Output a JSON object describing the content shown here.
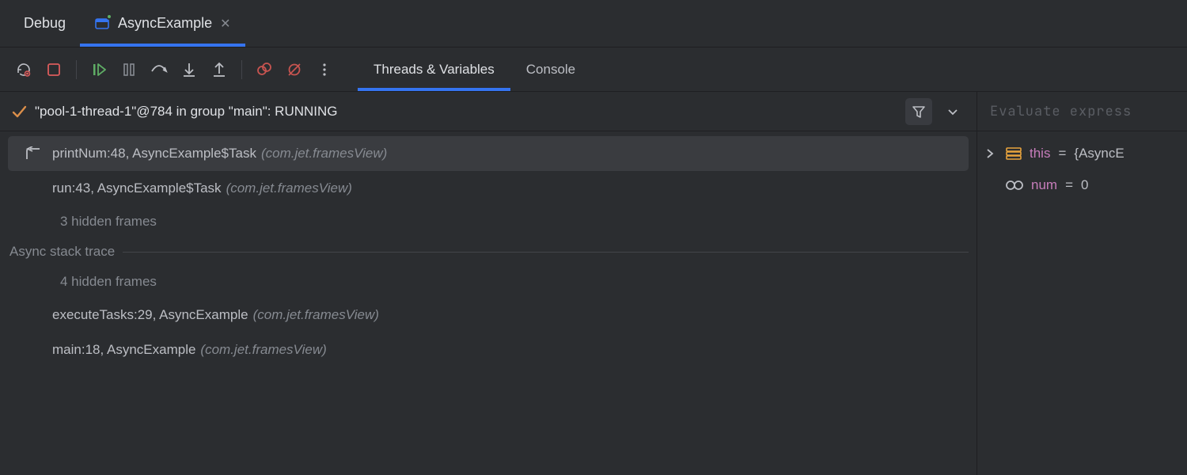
{
  "toolWindow": {
    "title": "Debug"
  },
  "runConfig": {
    "name": "AsyncExample"
  },
  "subTabs": {
    "threadsVariables": "Threads & Variables",
    "console": "Console"
  },
  "thread": {
    "label": "\"pool-1-thread-1\"@784 in group \"main\": RUNNING"
  },
  "frames": {
    "selected": {
      "text": "printNum:48, AsyncExample$Task",
      "pkg": "(com.jet.framesView)"
    },
    "f1": {
      "text": "run:43, AsyncExample$Task",
      "pkg": "(com.jet.framesView)"
    },
    "hidden1": "3 hidden frames",
    "asyncLabel": "Async stack trace",
    "hidden2": "4 hidden frames",
    "f2": {
      "text": "executeTasks:29, AsyncExample",
      "pkg": "(com.jet.framesView)"
    },
    "f3": {
      "text": "main:18, AsyncExample",
      "pkg": "(com.jet.framesView)"
    }
  },
  "evaluate": {
    "placeholder": "Evaluate express"
  },
  "variables": {
    "this": {
      "name": "this",
      "value": "{AsyncE"
    },
    "num": {
      "name": "num",
      "value": "0"
    }
  },
  "colors": {
    "accent": "#3574f0",
    "resume": "#5fad65",
    "stop": "#db5c5c",
    "breakpoint": "#c75450"
  }
}
